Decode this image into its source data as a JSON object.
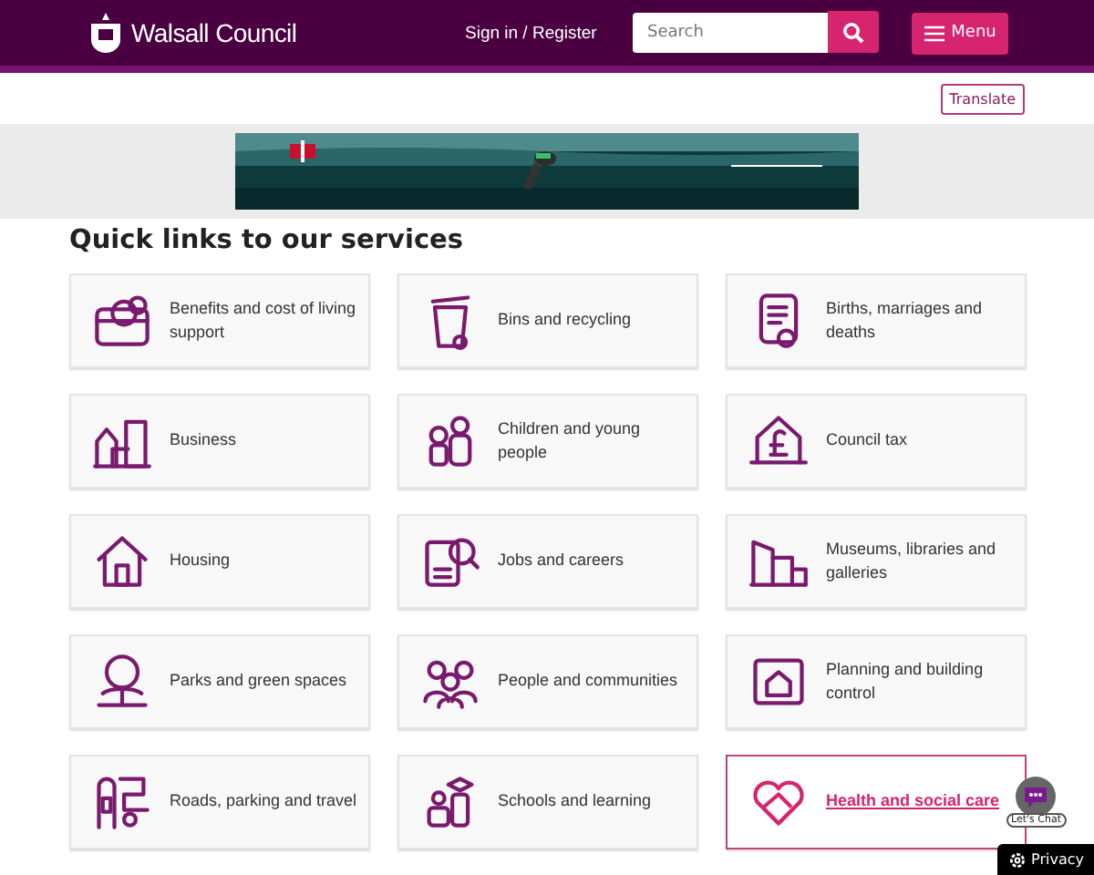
{
  "header": {
    "logo_text": "Walsall Council",
    "sign_in": "Sign in / Register",
    "search": {
      "placeholder": "Search"
    },
    "menu_button": "Menu"
  },
  "translate_button": "Translate",
  "quick_links": {
    "title": "Quick links to our services",
    "items": [
      {
        "label": "Benefits and cost of living support",
        "highlighted": false
      },
      {
        "label": "Bins and recycling",
        "highlighted": false
      },
      {
        "label": "Births, marriages and deaths",
        "highlighted": false
      },
      {
        "label": "Business",
        "highlighted": false
      },
      {
        "label": "Children and young people",
        "highlighted": false
      },
      {
        "label": "Council tax",
        "highlighted": false
      },
      {
        "label": "Housing",
        "highlighted": false
      },
      {
        "label": "Jobs and careers",
        "highlighted": false
      },
      {
        "label": "Museums, libraries and galleries",
        "highlighted": false
      },
      {
        "label": "Parks and green spaces",
        "highlighted": false
      },
      {
        "label": "People and communities",
        "highlighted": false
      },
      {
        "label": "Planning and building control",
        "highlighted": false
      },
      {
        "label": "Roads, parking and travel",
        "highlighted": false
      },
      {
        "label": "Schools and learning",
        "highlighted": false
      },
      {
        "label": "Health and social care",
        "highlighted": true
      }
    ]
  },
  "chat_widget": {
    "label": "Let's Chat"
  },
  "privacy_button": "Privacy"
}
